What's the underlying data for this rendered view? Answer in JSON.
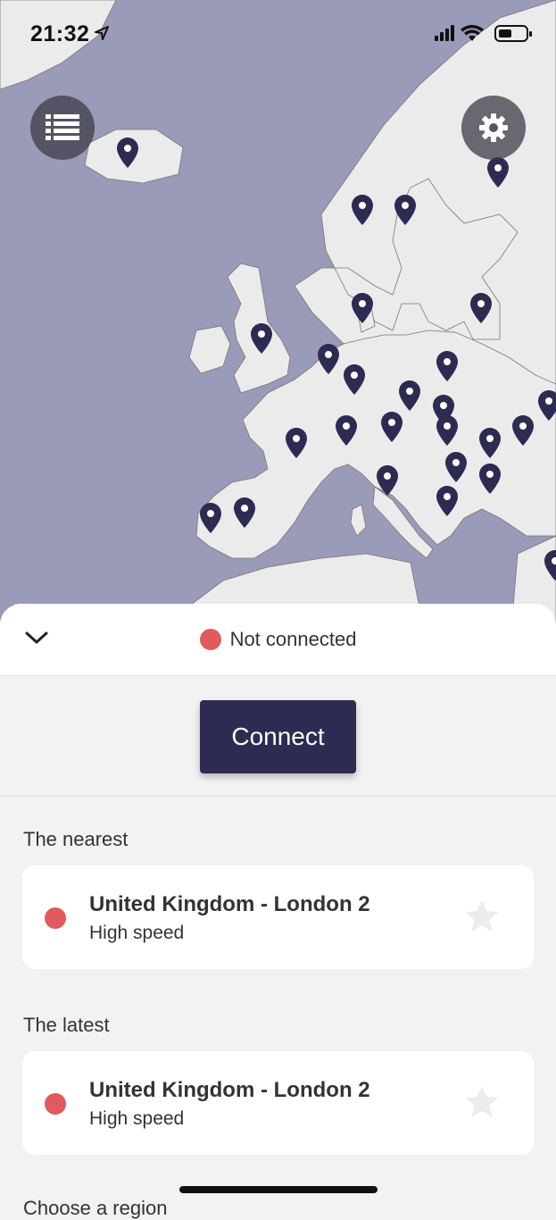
{
  "status_bar": {
    "time": "21:32",
    "icons": [
      "location-arrow-icon",
      "cellular-signal-icon",
      "wifi-icon",
      "battery-icon"
    ]
  },
  "map": {
    "buttons": [
      "server-list-icon",
      "settings-gear-icon"
    ],
    "water_color": "#9a9bb8",
    "land_color": "#ebebeb",
    "pin_color": "#2d2b52"
  },
  "connection": {
    "status": "Not connected",
    "status_color": "#e05a5e",
    "connect_label": "Connect"
  },
  "nearest": {
    "label": "The nearest",
    "server_name": "United Kingdom - London 2",
    "server_sub": "High speed"
  },
  "latest": {
    "label": "The latest",
    "server_name": "United Kingdom - London 2",
    "server_sub": "High speed"
  },
  "next_section": {
    "label": "Choose a region"
  }
}
